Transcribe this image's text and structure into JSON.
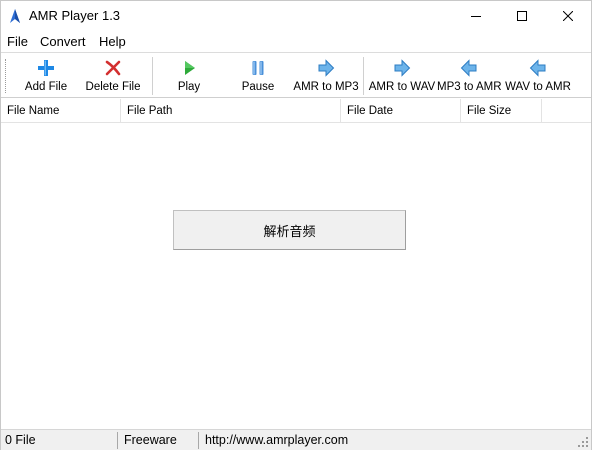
{
  "window": {
    "title": "AMR Player 1.3",
    "icon": "amr-player-app-icon"
  },
  "menu": {
    "items": [
      "File",
      "Convert",
      "Help"
    ]
  },
  "toolbar": {
    "buttons": [
      {
        "label": "Add File",
        "icon": "plus-icon",
        "color": "#1e88e5"
      },
      {
        "label": "Delete File",
        "icon": "red-x-icon",
        "color": "#d32f2f"
      },
      {
        "label": "Play",
        "icon": "play-icon",
        "color": "#2eaa3a"
      },
      {
        "label": "Pause",
        "icon": "pause-icon",
        "color": "#4a90d9"
      },
      {
        "label": "AMR to MP3",
        "icon": "arrow-right-icon",
        "color": "#5aa9e6"
      },
      {
        "label": "AMR to WAV",
        "icon": "arrow-right-icon",
        "color": "#5aa9e6"
      },
      {
        "label": "MP3 to AMR",
        "icon": "arrow-left-icon",
        "color": "#5aa9e6"
      },
      {
        "label": "WAV to AMR",
        "icon": "arrow-left-icon",
        "color": "#5aa9e6"
      }
    ]
  },
  "file_list": {
    "columns": [
      "File Name",
      "File Path",
      "File Date",
      "File Size"
    ],
    "rows": []
  },
  "parse_button": {
    "label": "解析音频"
  },
  "statusbar": {
    "file_count": "0 File",
    "license": "Freeware",
    "url": "http://www.amrplayer.com"
  }
}
